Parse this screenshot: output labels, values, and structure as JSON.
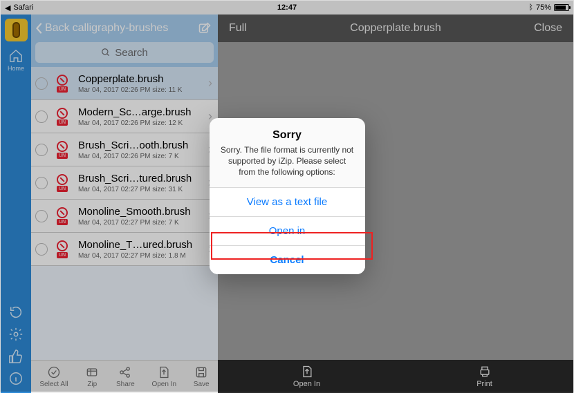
{
  "statusbar": {
    "app": "Safari",
    "time": "12:47",
    "battery_pct": "75%",
    "battery_fill_pct": 75
  },
  "sidebar": {
    "home_label": "Home"
  },
  "filepane": {
    "back_label": "Back",
    "title": "calligraphy-brushes",
    "search_placeholder": "Search",
    "files": [
      {
        "name": "Copperplate.brush",
        "meta": "Mar 04, 2017 02:26 PM  size: 11 K",
        "selected": true
      },
      {
        "name": "Modern_Sc…arge.brush",
        "meta": "Mar 04, 2017 02:26 PM  size: 12 K",
        "selected": false
      },
      {
        "name": "Brush_Scri…ooth.brush",
        "meta": "Mar 04, 2017 02:26 PM  size: 7 K",
        "selected": false
      },
      {
        "name": "Brush_Scri…tured.brush",
        "meta": "Mar 04, 2017 02:27 PM  size: 31 K",
        "selected": false
      },
      {
        "name": "Monoline_Smooth.brush",
        "meta": "Mar 04, 2017 02:27 PM  size: 7 K",
        "selected": false
      },
      {
        "name": "Monoline_T…ured.brush",
        "meta": "Mar 04, 2017 02:27 PM  size: 1.8 M",
        "selected": false
      }
    ],
    "toolbar": {
      "select_all": "Select All",
      "zip": "Zip",
      "share": "Share",
      "open_in": "Open In",
      "save": "Save"
    }
  },
  "preview": {
    "left_action": "Full",
    "title": "Copperplate.brush",
    "close": "Close",
    "footer_open_in": "Open In",
    "footer_print": "Print"
  },
  "dialog": {
    "title": "Sorry",
    "message": "Sorry. The file format is currently not supported by iZip. Please select from the following options:",
    "btn_view_text": "View as a text file",
    "btn_open_in": "Open in",
    "btn_cancel": "Cancel"
  },
  "badge_text": "UN"
}
